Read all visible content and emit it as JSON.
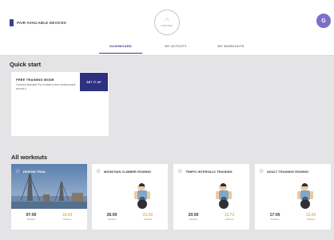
{
  "header": {
    "device_status": "PAIR AVAILABLE DEVICES",
    "logo_text": "ASENSEI",
    "avatar_initial": "G",
    "tabs": [
      {
        "label": "DASHBOARD",
        "active": true
      },
      {
        "label": "MY ACTIVITY",
        "active": false
      },
      {
        "label": "MY WORKOUTS",
        "active": false
      }
    ]
  },
  "quick_start": {
    "title": "Quick start",
    "card_title": "FREE TRAINING MODE",
    "card_description": "Connect Asensei Pro to start a free workout and record it",
    "button_label": "SET IT UP"
  },
  "all_workouts": {
    "title": "All workouts",
    "items": [
      {
        "name": "DESIGN TRIAL",
        "duration": "07:00",
        "duration_label": "Duration",
        "calories": "18.00",
        "calories_label": "Calories",
        "image": "photo"
      },
      {
        "name": "MOUNTAIN CLIMBER ROWING",
        "duration": "26:00",
        "duration_label": "Duration",
        "calories": "21.00",
        "calories_label": "Calories",
        "image": "illustration"
      },
      {
        "name": "TEMPO INTERVALS TRAINING",
        "duration": "20:00",
        "duration_label": "Duration",
        "calories": "12.72",
        "calories_label": "Calories",
        "image": "illustration"
      },
      {
        "name": "ADULT TRAINING ROWING",
        "duration": "17:00",
        "duration_label": "Duration",
        "calories": "12.00",
        "calories_label": "Calories",
        "image": "illustration"
      }
    ]
  },
  "colors": {
    "accent": "#3b3f8f",
    "button": "#2e3080",
    "calories": "#e8b84a",
    "avatar": "#7a70c8",
    "background": "#e4e4e6"
  }
}
